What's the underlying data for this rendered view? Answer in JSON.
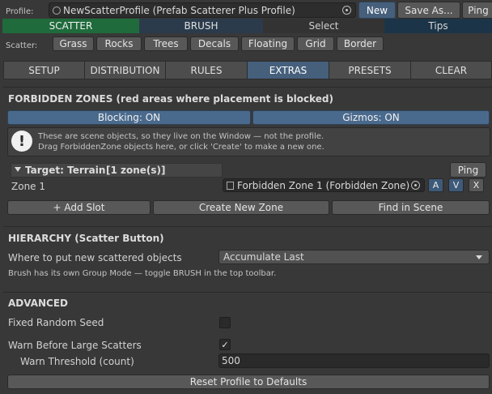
{
  "profile": {
    "label": "Profile:",
    "value": "NewScatterProfile (Prefab Scatterer Plus Profile)",
    "new_label": "New",
    "save_as_label": "Save As...",
    "ping_label": "Ping"
  },
  "mode_tabs": [
    "SCATTER",
    "BRUSH",
    "Select",
    "Tips"
  ],
  "scatter": {
    "label": "Scatter:",
    "types": [
      "Grass",
      "Rocks",
      "Trees",
      "Decals",
      "Floating",
      "Grid",
      "Border"
    ]
  },
  "section_tabs": [
    "SETUP",
    "DISTRIBUTION",
    "RULES",
    "EXTRAS",
    "PRESETS",
    "CLEAR"
  ],
  "active_section_tab": "EXTRAS",
  "forbidden": {
    "heading": "FORBIDDEN ZONES  (red areas where placement is blocked)",
    "blocking_label": "Blocking: ON",
    "gizmos_label": "Gizmos: ON",
    "info_line1": "These are scene objects, so they live on the Window — not the profile.",
    "info_line2": "Drag ForbiddenZone objects here, or click 'Create' to make a new one.",
    "target_label": "Target: Terrain",
    "zone_count": "[1 zone(s)]",
    "target_ping": "Ping",
    "zone_label": "Zone 1",
    "zone_value": "Forbidden Zone 1 (Forbidden Zone)",
    "zone_btn_a": "A",
    "zone_btn_v": "V",
    "zone_btn_x": "X",
    "add_slot": "+ Add Slot",
    "create_zone": "Create New Zone",
    "find_in_scene": "Find in Scene"
  },
  "hierarchy": {
    "heading": "HIERARCHY  (Scatter Button)",
    "where_label": "Where to put new scattered objects",
    "where_value": "Accumulate Last",
    "note": "Brush has its own Group Mode — toggle BRUSH in the top toolbar."
  },
  "advanced": {
    "heading": "ADVANCED",
    "fixed_seed_label": "Fixed Random Seed",
    "fixed_seed_checked": false,
    "warn_label": "Warn Before Large Scatters",
    "warn_checked": true,
    "warn_threshold_label": "Warn Threshold (count)",
    "warn_threshold_value": "500",
    "reset_label": "Reset Profile to Defaults"
  },
  "colors": {
    "scatter_tab": "#1f6b3c",
    "brush_tab": "#2b3b4c",
    "select_tab": "#333333",
    "tips_tab": "#1c3447",
    "active_blue": "#46607c",
    "blocking_bg": "#4a6a8d",
    "warning_icon": "#f0f0f0"
  }
}
